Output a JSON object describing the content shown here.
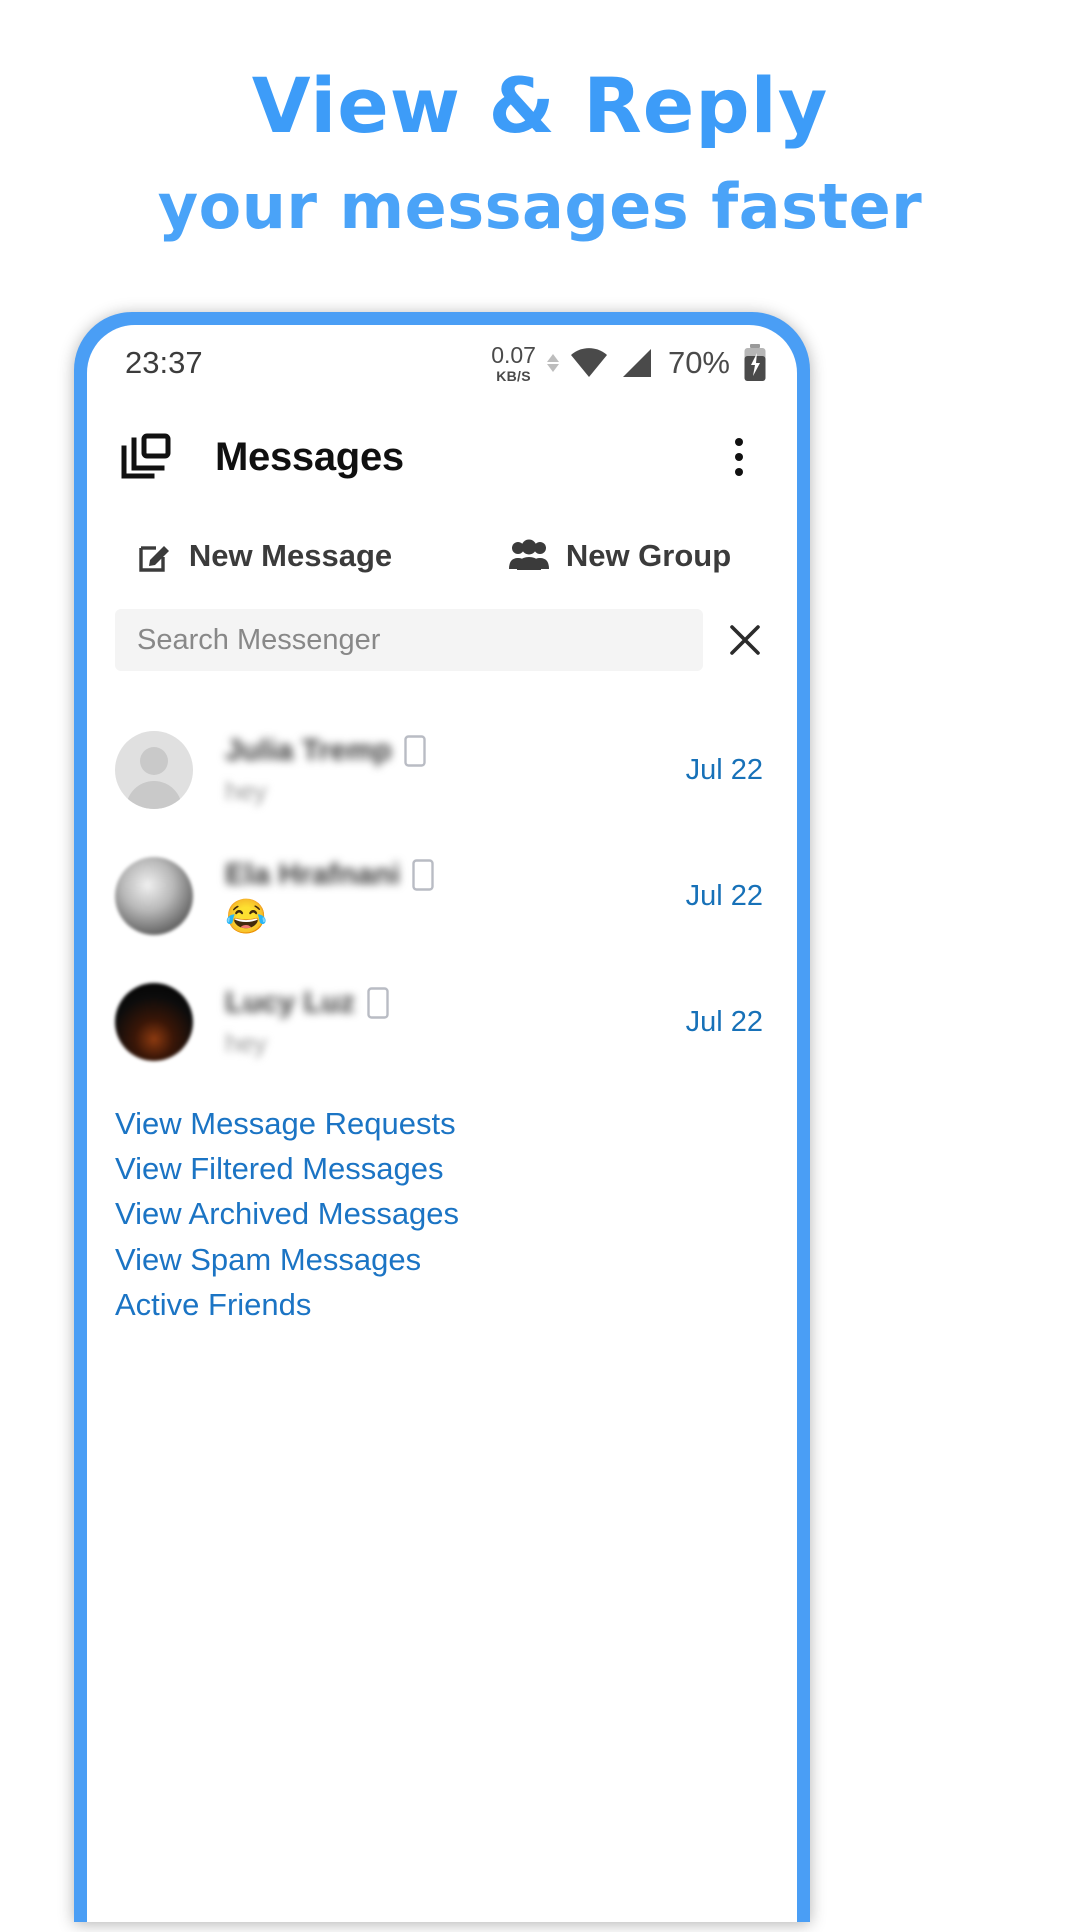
{
  "promo": {
    "line1": "View & Reply",
    "line2": "your messages faster",
    "accent_color": "#4a9ef5"
  },
  "status_bar": {
    "time": "23:37",
    "net_speed_value": "0.07",
    "net_speed_unit": "KB/S",
    "wifi_icon": "wifi-icon",
    "signal_icon": "cell-signal-icon",
    "battery_percent": "70%",
    "battery_icon": "battery-charging-icon"
  },
  "app_header": {
    "left_icon": "multi-window-icon",
    "title": "Messages",
    "overflow_icon": "overflow-menu-icon"
  },
  "actions": [
    {
      "label": "New Message",
      "icon": "compose-pencil-icon"
    },
    {
      "label": "New Group",
      "icon": "people-group-icon"
    }
  ],
  "search": {
    "placeholder": "Search Messenger",
    "value": "",
    "clear_icon": "close-icon"
  },
  "conversations": [
    {
      "name": "Julia Tremp",
      "preview": "hey",
      "preview_is_emoji": false,
      "date": "Jul 22",
      "avatar_kind": "placeholder",
      "device_icon": "mobile-phone-icon"
    },
    {
      "name": "Ela Hrafnani",
      "preview": "😂",
      "preview_is_emoji": true,
      "date": "Jul 22",
      "avatar_kind": "photo-gray",
      "device_icon": "mobile-phone-icon"
    },
    {
      "name": "Lucy Luz",
      "preview": "hey",
      "preview_is_emoji": false,
      "date": "Jul 22",
      "avatar_kind": "photo-dark",
      "device_icon": "mobile-phone-icon"
    }
  ],
  "links": [
    {
      "label": "View Message Requests"
    },
    {
      "label": "View Filtered Messages"
    },
    {
      "label": "View Archived Messages"
    },
    {
      "label": "View Spam Messages"
    },
    {
      "label": "Active Friends"
    }
  ]
}
